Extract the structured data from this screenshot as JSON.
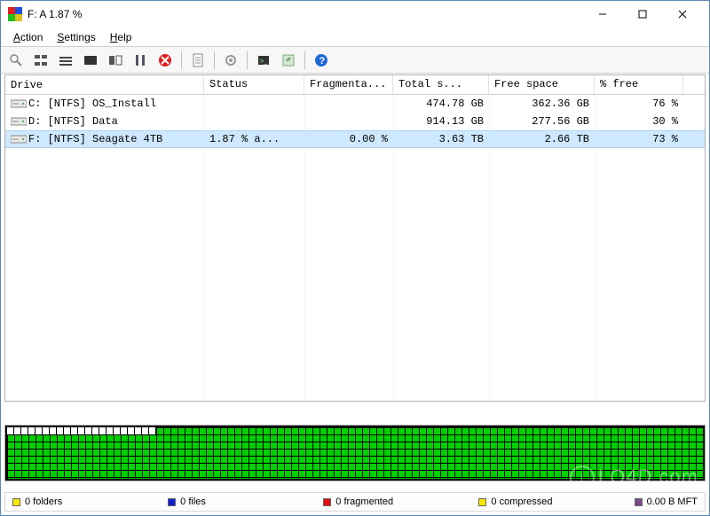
{
  "window": {
    "title": "F:  A   1.87 %"
  },
  "menu": {
    "action": "Action",
    "settings": "Settings",
    "help": "Help"
  },
  "columns": {
    "drive": "Drive",
    "status": "Status",
    "frag": "Fragmenta...",
    "total": "Total s...",
    "free": "Free space",
    "pfree": "% free"
  },
  "rows": [
    {
      "drive": "C: [NTFS]  OS_Install",
      "status": "",
      "frag": "",
      "total": "474.78 GB",
      "free": "362.36 GB",
      "pfree": "76 %",
      "selected": false
    },
    {
      "drive": "D: [NTFS]  Data",
      "status": "",
      "frag": "",
      "total": "914.13 GB",
      "free": "277.56 GB",
      "pfree": "30 %",
      "selected": false
    },
    {
      "drive": "F: [NTFS]  Seagate 4TB",
      "status": "1.87 % a...",
      "frag": "0.00 %",
      "total": "3.63 TB",
      "free": "2.66 TB",
      "pfree": "73 %",
      "selected": true
    }
  ],
  "legend": {
    "folders": "0 folders",
    "files": "0 files",
    "fragmented": "0 fragmented",
    "compressed": "0 compressed",
    "mft": "0.00 B MFT",
    "colors": {
      "folders": "#f6e600",
      "files": "#1020d0",
      "fragmented": "#e01010",
      "compressed": "#f6e600",
      "mft": "#7a4a8a"
    }
  },
  "watermark": "LO4D.com"
}
